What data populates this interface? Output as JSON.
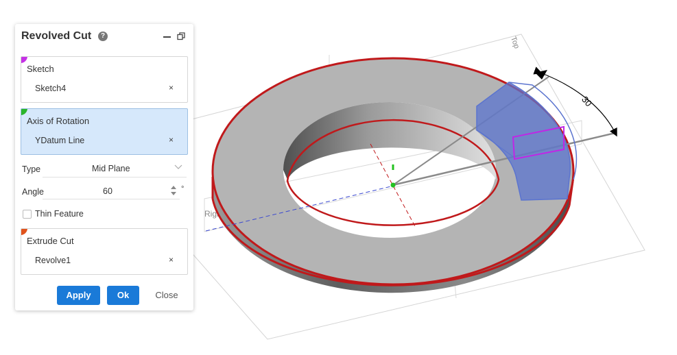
{
  "panel": {
    "title": "Revolved Cut",
    "sketch": {
      "label": "Sketch",
      "value": "Sketch4",
      "corner_color": "#c531e6"
    },
    "axis": {
      "label": "Axis of Rotation",
      "value": "YDatum Line",
      "corner_color": "#2bb52b"
    },
    "type": {
      "label": "Type",
      "value": "Mid Plane"
    },
    "angle": {
      "label": "Angle",
      "value": "60",
      "unit": "°"
    },
    "thin_feature": {
      "label": "Thin Feature",
      "checked": false
    },
    "extrude_cut": {
      "label": "Extrude Cut",
      "value": "Revolve1",
      "corner_color": "#e0531c"
    },
    "clear_glyph": "×",
    "buttons": {
      "apply": "Apply",
      "ok": "Ok",
      "close": "Close"
    },
    "accent": "#1a7ad8"
  },
  "viewport": {
    "dimension_label": "30",
    "plane_top_label": "Top",
    "plane_right_label": "Righ",
    "colors": {
      "body": "#b8b8b8",
      "edge": "#c0191b",
      "cut_preview": "#5b74cf",
      "sketch": "#c026e6",
      "axis_point": "#23c11f"
    }
  }
}
